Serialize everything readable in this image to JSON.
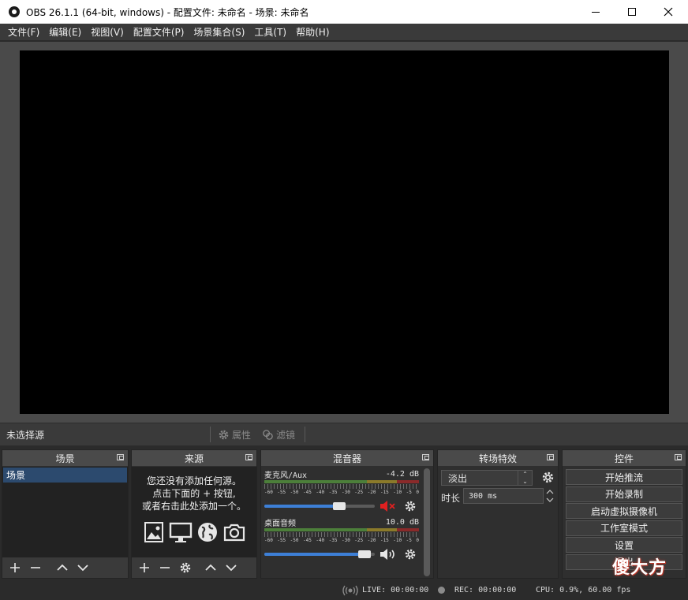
{
  "window": {
    "title": "OBS 26.1.1 (64-bit, windows) - 配置文件: 未命名 - 场景: 未命名"
  },
  "menu": [
    "文件(F)",
    "编辑(E)",
    "视图(V)",
    "配置文件(P)",
    "场景集合(S)",
    "工具(T)",
    "帮助(H)"
  ],
  "sourcebar": {
    "no_selection": "未选择源",
    "properties": "属性",
    "filters": "滤镜"
  },
  "docks": {
    "scenes": {
      "title": "场景",
      "items": [
        "场景"
      ]
    },
    "sources": {
      "title": "来源",
      "empty_lines": [
        "您还没有添加任何源。",
        "点击下面的 + 按钮,",
        "或者右击此处添加一个。"
      ]
    },
    "mixer": {
      "title": "混音器",
      "channels": [
        {
          "name": "麦克风/Aux",
          "level": "-4.2 dB",
          "volume": 0.7,
          "muted": true
        },
        {
          "name": "桌面音频",
          "level": "10.0 dB",
          "volume": 0.96,
          "muted": false
        }
      ],
      "scale": [
        "-60",
        "-55",
        "-50",
        "-45",
        "-40",
        "-35",
        "-30",
        "-25",
        "-20",
        "-15",
        "-10",
        "-5",
        "0"
      ]
    },
    "transitions": {
      "title": "转场特效",
      "selected": "淡出",
      "duration_label": "时长",
      "duration_value": "300 ms"
    },
    "controls": {
      "title": "控件",
      "buttons": [
        "开始推流",
        "开始录制",
        "启动虚拟摄像机",
        "工作室模式",
        "设置",
        "退出"
      ]
    }
  },
  "status": {
    "live": "LIVE: 00:00:00",
    "rec": "REC: 00:00:00",
    "cpu": "CPU: 0.9%, 60.00 fps"
  },
  "watermark": "傻大方",
  "colors": {
    "accent": "#3d7fd6",
    "muted_icon": "#e02020",
    "scene_selected": "#2c4a6e"
  }
}
